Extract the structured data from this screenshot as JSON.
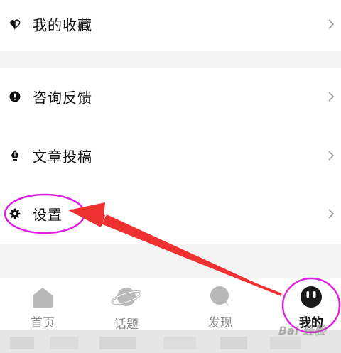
{
  "menu": {
    "favorites": {
      "label": "我的收藏",
      "icon": "heart-icon"
    },
    "feedback": {
      "label": "咨询反馈",
      "icon": "exclamation-icon"
    },
    "contribute": {
      "label": "文章投稿",
      "icon": "pen-nib-icon"
    },
    "settings": {
      "label": "设置",
      "icon": "gear-icon"
    }
  },
  "tabbar": {
    "tabs": [
      {
        "label": "首页",
        "icon": "home-icon",
        "active": false
      },
      {
        "label": "话题",
        "icon": "planet-icon",
        "active": false
      },
      {
        "label": "发现",
        "icon": "discover-icon",
        "active": false
      },
      {
        "label": "我的",
        "icon": "profile-face-icon",
        "active": true
      }
    ]
  },
  "annotation": {
    "highlight_color": "#e020e0",
    "arrow_color": "#ee3030"
  },
  "watermark": {
    "text": "Bai 经验"
  }
}
